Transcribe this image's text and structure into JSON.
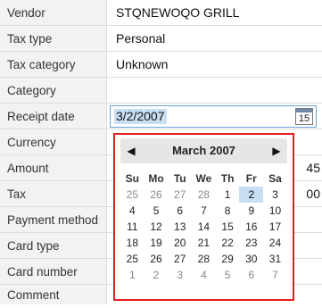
{
  "fields": {
    "vendor": {
      "label": "Vendor",
      "value": "STQNEWOQO GRILL"
    },
    "tax_type": {
      "label": "Tax type",
      "value": "Personal"
    },
    "tax_category": {
      "label": "Tax category",
      "value": "Unknown"
    },
    "category": {
      "label": "Category",
      "value": ""
    },
    "receipt_date": {
      "label": "Receipt date",
      "value": "3/2/2007"
    },
    "currency": {
      "label": "Currency",
      "value": ""
    },
    "amount": {
      "label": "Amount",
      "value_visible": "45"
    },
    "tax": {
      "label": "Tax",
      "value_visible": "00"
    },
    "payment_method": {
      "label": "Payment method",
      "value": ""
    },
    "card_type": {
      "label": "Card type",
      "value": ""
    },
    "card_number": {
      "label": "Card number",
      "value": ""
    },
    "comment": {
      "label": "Comment",
      "value": ""
    }
  },
  "calendar_icon": {
    "day": "15"
  },
  "datepicker": {
    "month_title": "March 2007",
    "prev": "◀",
    "next": "▶",
    "weekdays": [
      "Su",
      "Mo",
      "Tu",
      "We",
      "Th",
      "Fr",
      "Sa"
    ],
    "weeks": [
      [
        "25",
        "26",
        "27",
        "28",
        "1",
        "2",
        "3"
      ],
      [
        "4",
        "5",
        "6",
        "7",
        "8",
        "9",
        "10"
      ],
      [
        "11",
        "12",
        "13",
        "14",
        "15",
        "16",
        "17"
      ],
      [
        "18",
        "19",
        "20",
        "21",
        "22",
        "23",
        "24"
      ],
      [
        "25",
        "26",
        "27",
        "28",
        "29",
        "30",
        "31"
      ],
      [
        "1",
        "2",
        "3",
        "4",
        "5",
        "6",
        "7"
      ]
    ],
    "other_month_flags": [
      [
        true,
        true,
        true,
        true,
        false,
        false,
        false
      ],
      [
        false,
        false,
        false,
        false,
        false,
        false,
        false
      ],
      [
        false,
        false,
        false,
        false,
        false,
        false,
        false
      ],
      [
        false,
        false,
        false,
        false,
        false,
        false,
        false
      ],
      [
        false,
        false,
        false,
        false,
        false,
        false,
        false
      ],
      [
        true,
        true,
        true,
        true,
        true,
        true,
        true
      ]
    ],
    "selected": {
      "week": 0,
      "day": 5
    }
  },
  "colors": {
    "highlight_border": "#e0201c",
    "selection": "#c8def3",
    "input_border": "#6aa3d4"
  }
}
